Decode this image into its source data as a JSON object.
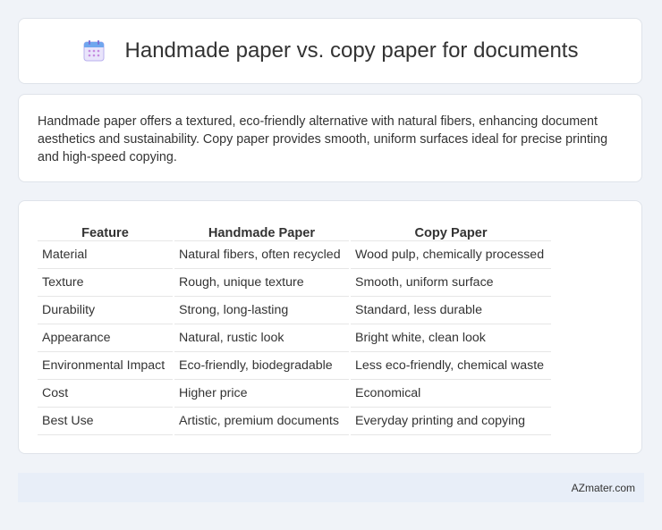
{
  "header": {
    "title": "Handmade paper vs. copy paper for documents",
    "icon": "calendar-icon"
  },
  "description": "Handmade paper offers a textured, eco-friendly alternative with natural fibers, enhancing document aesthetics and sustainability. Copy paper provides smooth, uniform surfaces ideal for precise printing and high-speed copying.",
  "table": {
    "columns": [
      "Feature",
      "Handmade Paper",
      "Copy Paper"
    ],
    "rows": [
      [
        "Material",
        "Natural fibers, often recycled",
        "Wood pulp, chemically processed"
      ],
      [
        "Texture",
        "Rough, unique texture",
        "Smooth, uniform surface"
      ],
      [
        "Durability",
        "Strong, long-lasting",
        "Standard, less durable"
      ],
      [
        "Appearance",
        "Natural, rustic look",
        "Bright white, clean look"
      ],
      [
        "Environmental Impact",
        "Eco-friendly, biodegradable",
        "Less eco-friendly, chemical waste"
      ],
      [
        "Cost",
        "Higher price",
        "Economical"
      ],
      [
        "Best Use",
        "Artistic, premium documents",
        "Everyday printing and copying"
      ]
    ]
  },
  "footer": {
    "text": "AZmater.com"
  },
  "colors": {
    "background": "#f0f3f8",
    "card": "#ffffff",
    "footer": "#e8eef8",
    "icon_accent": "#7b6fd6"
  }
}
